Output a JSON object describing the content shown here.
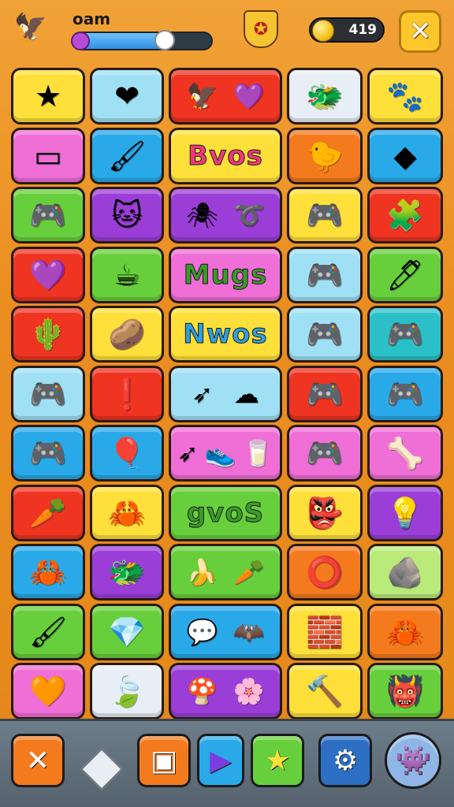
{
  "header": {
    "player_name": "oam",
    "xp_progress": 0.66,
    "coins": "419",
    "left_emblem": "eagle-crest-icon",
    "center_emblem": "eagle-shield-icon",
    "close_icon": "close-icon"
  },
  "board": {
    "rows": [
      [
        {
          "color": "yellow",
          "icons": [
            "star"
          ],
          "glyphs": [
            "★"
          ],
          "span": 1
        },
        {
          "color": "lblue",
          "icons": [
            "heart"
          ],
          "glyphs": [
            "❤"
          ],
          "span": 1
        },
        {
          "color": "red",
          "icons": [
            "eagle-crest",
            "heart"
          ],
          "glyphs": [
            "🦅",
            "💜"
          ],
          "span": 1.5
        },
        {
          "color": "white",
          "icons": [
            "dragon"
          ],
          "glyphs": [
            "🐲"
          ],
          "span": 1
        },
        {
          "color": "yellow",
          "icons": [
            "creature"
          ],
          "glyphs": [
            "🐾"
          ],
          "span": 1
        }
      ],
      [
        {
          "color": "pink",
          "icons": [
            "tablet"
          ],
          "glyphs": [
            "▭"
          ],
          "span": 1
        },
        {
          "color": "blue",
          "icons": [
            "brush"
          ],
          "glyphs": [
            "🖌"
          ],
          "span": 1
        },
        {
          "color": "yellow",
          "word": "Bvos",
          "span": 1.5
        },
        {
          "color": "orange",
          "icons": [
            "creature"
          ],
          "glyphs": [
            "🐤"
          ],
          "span": 1
        },
        {
          "color": "blue",
          "icons": [
            "card"
          ],
          "glyphs": [
            "◆"
          ],
          "span": 1
        }
      ],
      [
        {
          "color": "green",
          "icons": [
            "gamepad"
          ],
          "glyphs": [
            "🎮"
          ],
          "span": 1
        },
        {
          "color": "purple",
          "icons": [
            "monster"
          ],
          "glyphs": [
            "🐱"
          ],
          "span": 1
        },
        {
          "color": "purple",
          "icons": [
            "bug",
            "swirl"
          ],
          "glyphs": [
            "🕷",
            "➰"
          ],
          "span": 1.5
        },
        {
          "color": "yellow",
          "icons": [
            "gamepad"
          ],
          "glyphs": [
            "🎮"
          ],
          "span": 1
        },
        {
          "color": "red",
          "icons": [
            "puzzle"
          ],
          "glyphs": [
            "🧩"
          ],
          "span": 1
        }
      ],
      [
        {
          "color": "red",
          "icons": [
            "heart"
          ],
          "glyphs": [
            "💜"
          ],
          "span": 1
        },
        {
          "color": "green",
          "icons": [
            "mug"
          ],
          "glyphs": [
            "☕"
          ],
          "span": 1
        },
        {
          "color": "pink",
          "word": "Mugs",
          "span": 1.5
        },
        {
          "color": "lblue",
          "icons": [
            "gamepad"
          ],
          "glyphs": [
            "🎮"
          ],
          "span": 1
        },
        {
          "color": "green",
          "icons": [
            "pen"
          ],
          "glyphs": [
            "🖊"
          ],
          "span": 1
        }
      ],
      [
        {
          "color": "red",
          "icons": [
            "cactus"
          ],
          "glyphs": [
            "🌵"
          ],
          "span": 1
        },
        {
          "color": "yellow",
          "icons": [
            "stone"
          ],
          "glyphs": [
            "🥔"
          ],
          "span": 1
        },
        {
          "color": "yellow",
          "word": "Nwos",
          "span": 1.5
        },
        {
          "color": "lblue",
          "icons": [
            "gamepad"
          ],
          "glyphs": [
            "🎮"
          ],
          "span": 1
        },
        {
          "color": "teal",
          "icons": [
            "gamepad"
          ],
          "glyphs": [
            "🎮"
          ],
          "span": 1
        }
      ],
      [
        {
          "color": "lblue",
          "icons": [
            "gamepad"
          ],
          "glyphs": [
            "🎮"
          ],
          "span": 1
        },
        {
          "color": "red",
          "icons": [
            "exclamation"
          ],
          "glyphs": [
            "❗"
          ],
          "span": 1
        },
        {
          "color": "lblue",
          "icons": [
            "arrow",
            "cloud"
          ],
          "glyphs": [
            "➶",
            "☁"
          ],
          "span": 1.5
        },
        {
          "color": "red",
          "icons": [
            "gamepad"
          ],
          "glyphs": [
            "🎮"
          ],
          "span": 1
        },
        {
          "color": "blue",
          "icons": [
            "gamepad"
          ],
          "glyphs": [
            "🎮"
          ],
          "span": 1
        }
      ],
      [
        {
          "color": "blue",
          "icons": [
            "gamepad"
          ],
          "glyphs": [
            "🎮"
          ],
          "span": 1
        },
        {
          "color": "blue",
          "icons": [
            "balloon"
          ],
          "glyphs": [
            "🎈"
          ],
          "span": 1
        },
        {
          "color": "pink",
          "icons": [
            "arrow",
            "shoe",
            "cup"
          ],
          "glyphs": [
            "➶",
            "👟",
            "🥛"
          ],
          "span": 1.5
        },
        {
          "color": "pink",
          "icons": [
            "gamepad"
          ],
          "glyphs": [
            "🎮"
          ],
          "span": 1
        },
        {
          "color": "pink",
          "icons": [
            "bone"
          ],
          "glyphs": [
            "🦴"
          ],
          "span": 1
        }
      ],
      [
        {
          "color": "red",
          "icons": [
            "carrot"
          ],
          "glyphs": [
            "🥕"
          ],
          "span": 1
        },
        {
          "color": "yellow",
          "icons": [
            "crab"
          ],
          "glyphs": [
            "🦀"
          ],
          "span": 1
        },
        {
          "color": "green",
          "word": "gvoS",
          "span": 1.5
        },
        {
          "color": "yellow",
          "icons": [
            "goblin"
          ],
          "glyphs": [
            "👺"
          ],
          "span": 1
        },
        {
          "color": "purple",
          "icons": [
            "lightbulb"
          ],
          "glyphs": [
            "💡"
          ],
          "span": 1
        }
      ],
      [
        {
          "color": "blue",
          "icons": [
            "crab"
          ],
          "glyphs": [
            "🦀"
          ],
          "span": 1
        },
        {
          "color": "purple",
          "icons": [
            "dragon"
          ],
          "glyphs": [
            "🐲"
          ],
          "span": 1
        },
        {
          "color": "green",
          "icons": [
            "banana",
            "carrot"
          ],
          "glyphs": [
            "🍌",
            "🥕"
          ],
          "span": 1.5
        },
        {
          "color": "orange",
          "icons": [
            "donut"
          ],
          "glyphs": [
            "⭕"
          ],
          "span": 1
        },
        {
          "color": "ltgreen",
          "icons": [
            "rock"
          ],
          "glyphs": [
            "🪨"
          ],
          "span": 1
        }
      ],
      [
        {
          "color": "green",
          "icons": [
            "brush"
          ],
          "glyphs": [
            "🖌"
          ],
          "span": 1
        },
        {
          "color": "green",
          "icons": [
            "crystal"
          ],
          "glyphs": [
            "💎"
          ],
          "span": 1
        },
        {
          "color": "blue",
          "icons": [
            "speech-bubble",
            "bat"
          ],
          "glyphs": [
            "💬",
            "🦇"
          ],
          "span": 1.5
        },
        {
          "color": "yellow",
          "icons": [
            "eraser"
          ],
          "glyphs": [
            "🧱"
          ],
          "span": 1
        },
        {
          "color": "orange",
          "icons": [
            "crab"
          ],
          "glyphs": [
            "🦀"
          ],
          "span": 1
        }
      ],
      [
        {
          "color": "pink",
          "icons": [
            "heart"
          ],
          "glyphs": [
            "🧡"
          ],
          "span": 1
        },
        {
          "color": "white",
          "icons": [
            "leaf"
          ],
          "glyphs": [
            "🍃"
          ],
          "span": 1
        },
        {
          "color": "purple",
          "icons": [
            "mushroom",
            "flower"
          ],
          "glyphs": [
            "🍄",
            "🌸"
          ],
          "span": 1.5
        },
        {
          "color": "yellow",
          "icons": [
            "hammer"
          ],
          "glyphs": [
            "🔨"
          ],
          "span": 1
        },
        {
          "color": "green",
          "icons": [
            "goblin"
          ],
          "glyphs": [
            "👹"
          ],
          "span": 1
        }
      ]
    ]
  },
  "toolbar": {
    "buttons": [
      {
        "name": "close-button",
        "icon": "close-icon",
        "glyph": "✕",
        "color": "#f47a1e"
      },
      {
        "name": "window-button",
        "icon": "window-icon",
        "glyph": "▣",
        "color": "#f47a1e"
      },
      {
        "name": "play-button",
        "icon": "play-icon",
        "glyph": "▶",
        "color": "#29a9e8"
      },
      {
        "name": "star-button",
        "icon": "star-icon",
        "glyph": "★",
        "color": "#68cf3c"
      },
      {
        "name": "settings-button",
        "icon": "gear-icon",
        "glyph": "⚙",
        "color": "#2d6fc2"
      },
      {
        "name": "monster-button",
        "icon": "monster-icon",
        "glyph": "👾",
        "color": "#8fb6e6"
      }
    ]
  }
}
